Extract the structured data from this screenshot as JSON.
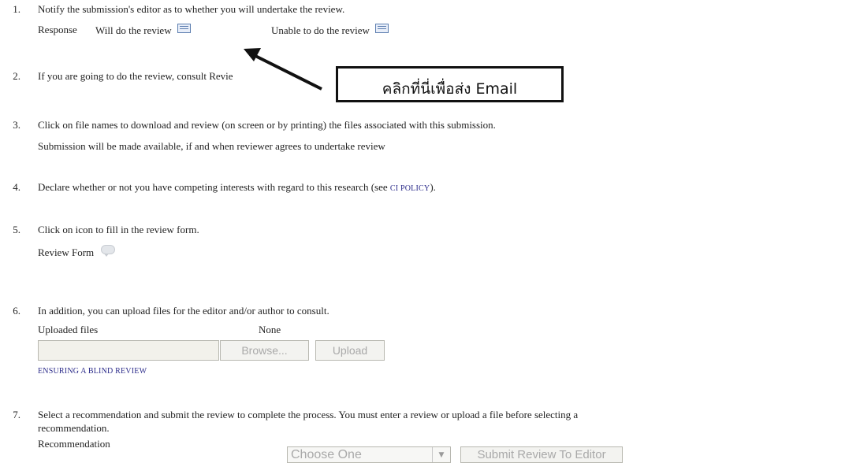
{
  "steps": [
    {
      "n": "1.",
      "text": "Notify the submission's editor as to whether you will undertake the review."
    },
    {
      "n": "2.",
      "text": "If you are going to do the review, consult Revie"
    },
    {
      "n": "3.",
      "text": "Click on file names to download and review (on screen or by printing) the files associated with this submission."
    },
    {
      "n": "4.",
      "text": "Declare whether or not you have competing interests with regard to this research (see",
      "link": "CI POLICY",
      "tail": ")."
    },
    {
      "n": "5.",
      "text": "Click on icon to fill in the review form."
    },
    {
      "n": "6.",
      "text": "In addition, you can upload files for the editor and/or author to consult."
    },
    {
      "n": "7.",
      "text": "Select a recommendation and submit the review to complete the process. You must enter a review or upload a file before selecting a",
      "text2": "recommendation."
    }
  ],
  "response": {
    "label": "Response",
    "will": "Will do the review",
    "unable": "Unable to do the review"
  },
  "submission_note": "Submission will be made available, if and when reviewer agrees to undertake review",
  "review_form_label": "Review Form",
  "uploaded": {
    "label": "Uploaded files",
    "value": "None",
    "browse": "Browse...",
    "upload": "Upload",
    "blind_link": "ENSURING A BLIND REVIEW"
  },
  "recommendation": {
    "label": "Recommendation",
    "select_value": "Choose One",
    "submit": "Submit Review To Editor"
  },
  "callout": {
    "text": "คลิกที่นี่เพื่อส่ง Email"
  },
  "colors": {
    "link": "#2b2b8a",
    "icon": "#5d7eb0",
    "disabled_text": "#a9a9a9"
  },
  "icons": {
    "email": "envelope-icon",
    "comment": "comment-bubble-icon",
    "arrow": "pointer-arrow"
  }
}
